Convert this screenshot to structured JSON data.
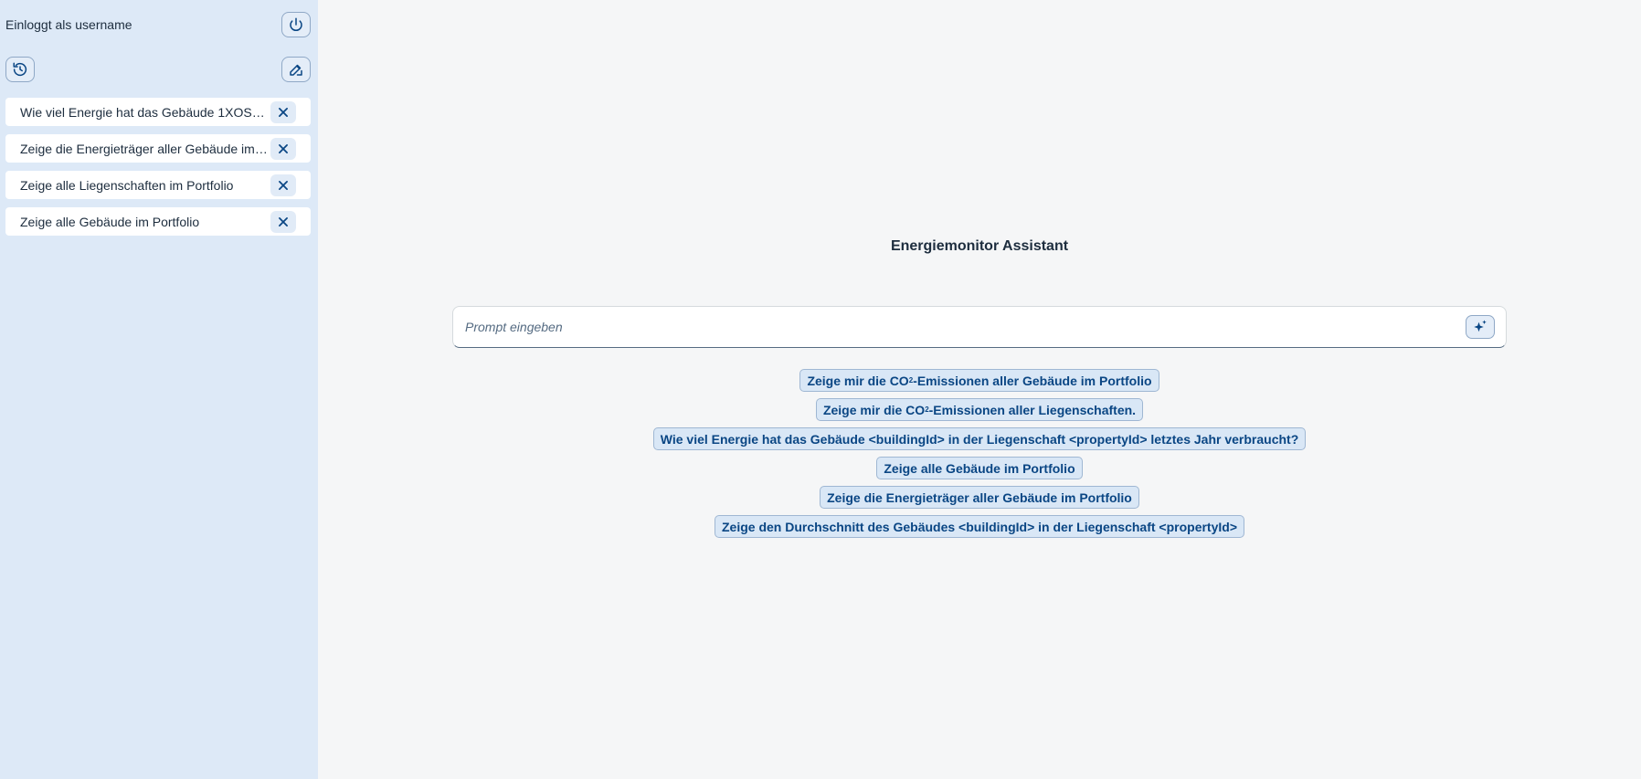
{
  "sidebar": {
    "user_label": "Einloggt als username",
    "history": [
      {
        "label": "Wie viel Energie hat das Gebäude 1XOSY..."
      },
      {
        "label": "Zeige die Energieträger aller Gebäude im ..."
      },
      {
        "label": "Zeige alle Liegenschaften im Portfolio"
      },
      {
        "label": "Zeige alle Gebäude im Portfolio"
      }
    ]
  },
  "main": {
    "title": "Energiemonitor Assistant",
    "prompt_placeholder": "Prompt eingeben",
    "suggestions": [
      {
        "pre": "Zeige mir die CO",
        "sub": "2",
        "post": "-Emissionen aller Gebäude im Portfolio"
      },
      {
        "pre": "Zeige mir die CO",
        "sub": "2",
        "post": "-Emissionen aller Liegenschaften."
      },
      {
        "pre": "Wie viel Energie hat das Gebäude <buildingId> in der Liegenschaft <propertyId> letztes Jahr verbraucht?",
        "sub": "",
        "post": ""
      },
      {
        "pre": "Zeige alle Gebäude im Portfolio",
        "sub": "",
        "post": ""
      },
      {
        "pre": "Zeige die Energieträger aller Gebäude im Portfolio",
        "sub": "",
        "post": ""
      },
      {
        "pre": "Zeige den Durchschnitt des Gebäudes <buildingId> in der Liegenschaft <propertyId>",
        "sub": "",
        "post": ""
      }
    ]
  },
  "colors": {
    "sidebar_bg": "#dde9f7",
    "main_bg": "#f5f6f7",
    "accent": "#0a4684",
    "chip_bg": "#d9e7f6"
  },
  "icons": {
    "logout": "power-icon",
    "history": "history-icon",
    "new_chat": "edit-icon",
    "remove": "close-icon",
    "send": "sparkle-icon"
  }
}
